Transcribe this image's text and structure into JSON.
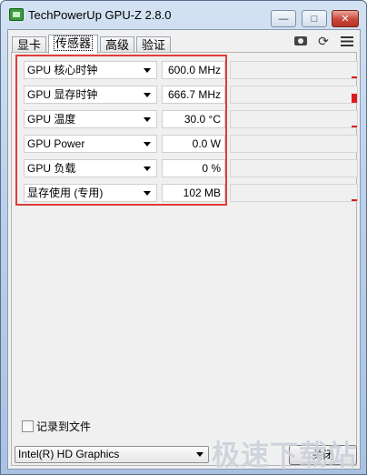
{
  "window": {
    "title": "TechPowerUp GPU-Z 2.8.0",
    "controls": {
      "minimize": "—",
      "maximize": "□",
      "close": "✕"
    }
  },
  "tabs": [
    {
      "label": "显卡",
      "active": false
    },
    {
      "label": "传感器",
      "active": true
    },
    {
      "label": "高级",
      "active": false
    },
    {
      "label": "验证",
      "active": false
    }
  ],
  "toolbar": {
    "icons": [
      "camera-icon",
      "refresh-icon",
      "menu-icon"
    ],
    "refresh_glyph": "⟳"
  },
  "sensors": [
    {
      "name": "GPU 核心时钟",
      "value": "600.0 MHz",
      "graph_level": 0.05
    },
    {
      "name": "GPU 显存时钟",
      "value": "666.7 MHz",
      "graph_level": 0.55
    },
    {
      "name": "GPU 温度",
      "value": "30.0 °C",
      "graph_level": 0.05
    },
    {
      "name": "GPU Power",
      "value": "0.0 W",
      "graph_level": 0
    },
    {
      "name": "GPU 负载",
      "value": "0 %",
      "graph_level": 0
    },
    {
      "name": "显存使用 (专用)",
      "value": "102 MB",
      "graph_level": 0.05
    }
  ],
  "log": {
    "label": "记录到文件",
    "checked": false
  },
  "gpu_select": {
    "selected": "Intel(R) HD Graphics"
  },
  "close_button": {
    "label": "关闭"
  },
  "watermark": {
    "text": "极速下载站"
  },
  "colors": {
    "highlight": "#e03c3c",
    "graph_bar": "#dd1a1a"
  }
}
